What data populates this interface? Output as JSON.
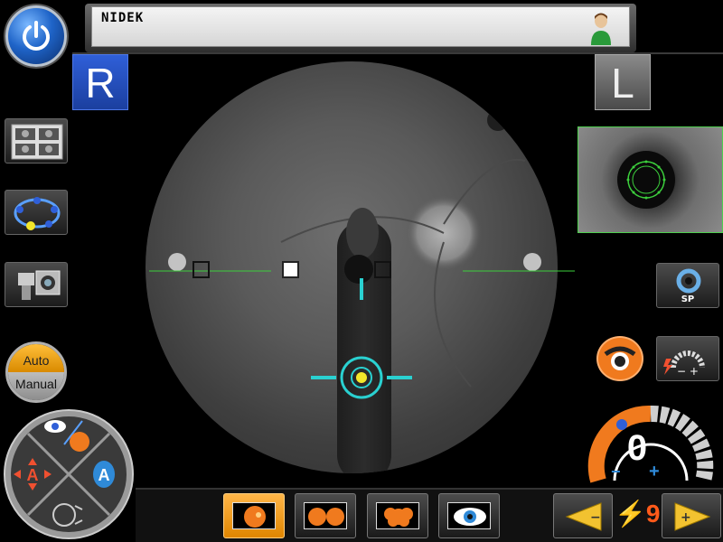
{
  "header": {
    "text": "NIDEK"
  },
  "eye": {
    "right_label": "R",
    "left_label": "L"
  },
  "focus_mode": {
    "auto_label": "Auto",
    "manual_label": "Manual"
  },
  "joystick": {
    "left_label": "A",
    "right_label": "A"
  },
  "small_pupil": {
    "label": "SP"
  },
  "diopter": {
    "value": "0",
    "minus": "−",
    "plus": "+"
  },
  "flash": {
    "count": "9"
  },
  "colors": {
    "accent_orange": "#f07a1e",
    "accent_blue": "#1f64c8",
    "target_cyan": "#2ad1d1",
    "guide_green": "#3ccf3c"
  }
}
